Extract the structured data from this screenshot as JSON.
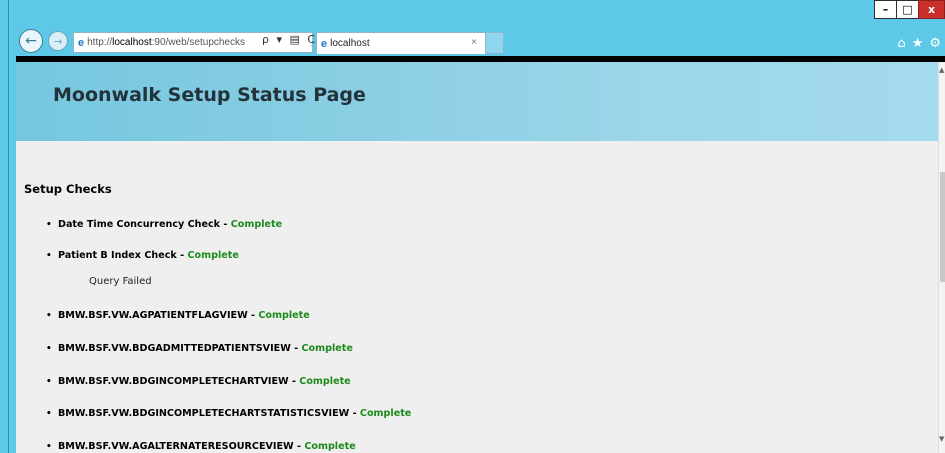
{
  "browser": {
    "url_prefix": "http://",
    "url_host": "localhost",
    "url_rest": ":90/web/setupchecks",
    "address_tools": "ρ ▾ ▤ C",
    "tab_title": "localhost",
    "tab_close": "×",
    "window_buttons": {
      "minimize": "–",
      "maximize": "□",
      "close": "x"
    },
    "right_icons": {
      "home": "⌂",
      "favorites": "★",
      "settings": "⚙"
    }
  },
  "page": {
    "title": "Moonwalk Setup Status Page",
    "section_title": "Setup Checks",
    "separator": " - ",
    "checks": [
      {
        "name": "Date Time Concurrency Check",
        "status": "Complete"
      },
      {
        "name": "Patient B Index Check",
        "status": "Complete",
        "note": "Query Failed"
      },
      {
        "name": "BMW.BSF.VW.AGPATIENTFLAGVIEW",
        "status": "Complete"
      },
      {
        "name": "BMW.BSF.VW.BDGADMITTEDPATIENTSVIEW",
        "status": "Complete"
      },
      {
        "name": "BMW.BSF.VW.BDGINCOMPLETECHARTVIEW",
        "status": "Complete"
      },
      {
        "name": "BMW.BSF.VW.BDGINCOMPLETECHARTSTATISTICSVIEW",
        "status": "Complete"
      },
      {
        "name": "BMW.BSF.VW.AGALTERNATERESOURCEVIEW",
        "status": "Complete"
      }
    ]
  },
  "colors": {
    "status_complete": "#1a8a1a",
    "header_accent": "#74c7df",
    "chrome": "#5ec8e8"
  }
}
